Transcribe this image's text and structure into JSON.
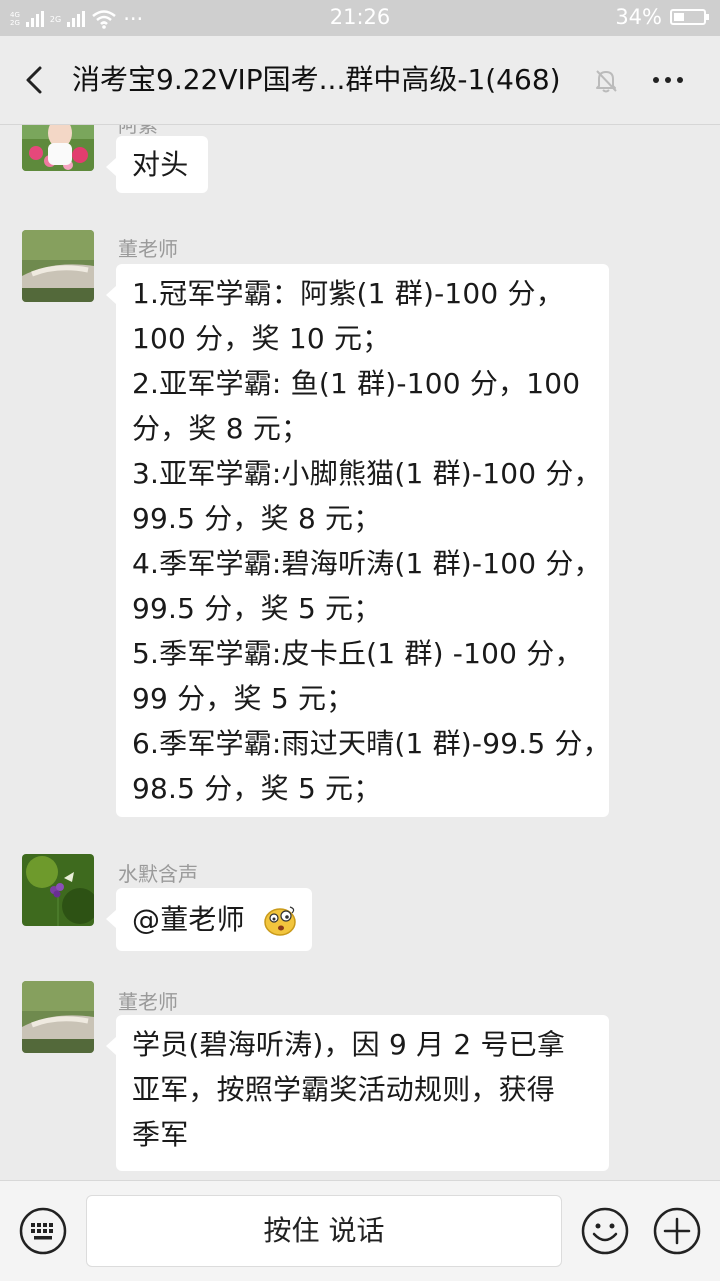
{
  "status_bar": {
    "net_top": "4G",
    "net_bottom": "2G",
    "net2": "2G",
    "dots": "···",
    "time": "21:26",
    "battery_text": "34%",
    "battery_level": 0.34
  },
  "header": {
    "title": "消考宝9.22VIP国考...群中高级-1(468)"
  },
  "messages": [
    {
      "sender": "阿紫",
      "lines": [
        "对头"
      ]
    },
    {
      "sender": "董老师",
      "lines": [
        "1.冠军学霸：阿紫(1 群)-100 分，",
        "100 分，奖 10 元；",
        "2.亚军学霸: 鱼(1 群)-100 分，100",
        "分，奖 8 元；",
        "3.亚军学霸:小脚熊猫(1 群)-100 分，",
        "99.5 分，奖 8 元；",
        "4.季军学霸:碧海听涛(1 群)-100 分，",
        "99.5 分，奖 5 元；",
        "5.季军学霸:皮卡丘(1 群) -100 分，",
        "99 分，奖 5 元；",
        "6.季军学霸:雨过天晴(1 群)-99.5 分，",
        "98.5 分，奖 5 元；"
      ]
    },
    {
      "sender": "水默含声",
      "text": "@董老师",
      "emoji": "dizzy-face-emoji"
    },
    {
      "sender": "董老师",
      "lines": [
        "学员(碧海听涛)，因 9 月 2 号已拿",
        "亚军，按照学霸奖活动规则，获得",
        "季军"
      ]
    }
  ],
  "input_bar": {
    "voice_label": "按住 说话",
    "icons": [
      "keyboard-icon",
      "emoji-icon",
      "plus-icon"
    ]
  }
}
